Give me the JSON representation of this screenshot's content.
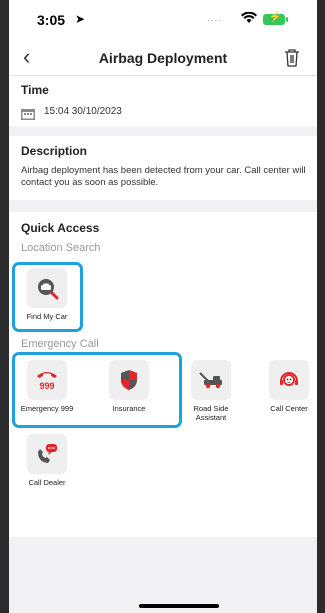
{
  "status_bar": {
    "time": "3:05",
    "location_glyph": "➤",
    "signal_dots": "....",
    "wifi_glyph": "📶",
    "battery_glyph": "⚡"
  },
  "header": {
    "title": "Airbag Deployment",
    "back_glyph": "‹"
  },
  "time_section": {
    "title": "Time",
    "value": "15:04 30/10/2023"
  },
  "description_section": {
    "title": "Description",
    "text": "Airbag deployment has been detected from your car. Call center will contact you as soon as possible."
  },
  "quick_access": {
    "title": "Quick Access",
    "location_search": {
      "label": "Location Search",
      "items": [
        {
          "label": "Find My Car",
          "icon": "car-search-icon"
        }
      ]
    },
    "emergency_call": {
      "label": "Emergency Call",
      "items": [
        {
          "label": "Emergency 999",
          "icon": "phone-999-icon",
          "badge": "999"
        },
        {
          "label": "Insurance",
          "icon": "shield-icon"
        },
        {
          "label": "Road Side Assistant",
          "icon": "tow-truck-icon"
        },
        {
          "label": "Call Center",
          "icon": "headset-agent-icon"
        },
        {
          "label": "Call Dealer",
          "icon": "phone-chat-icon"
        }
      ]
    }
  },
  "colors": {
    "accent": "#e3262b",
    "highlight": "#1da1e0",
    "background": "#f2f2f4"
  }
}
